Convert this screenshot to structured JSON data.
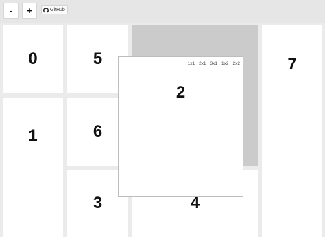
{
  "toolbar": {
    "minus_label": "-",
    "plus_label": "+",
    "github_label": "GitHub"
  },
  "tiles": [
    {
      "label": "0"
    },
    {
      "label": "5"
    },
    {
      "label": "7"
    },
    {
      "label": "1"
    },
    {
      "label": "6"
    },
    {
      "label": "3"
    },
    {
      "label": "4"
    }
  ],
  "dragging_tile": {
    "label": "2",
    "size_options": [
      "1x1",
      "2x1",
      "3x1",
      "1x2",
      "2x2"
    ]
  },
  "colors": {
    "background": "#e6e6e6",
    "tile": "#ffffff",
    "placeholder": "#cbcbcb"
  },
  "icons": {
    "github": "github-icon"
  }
}
